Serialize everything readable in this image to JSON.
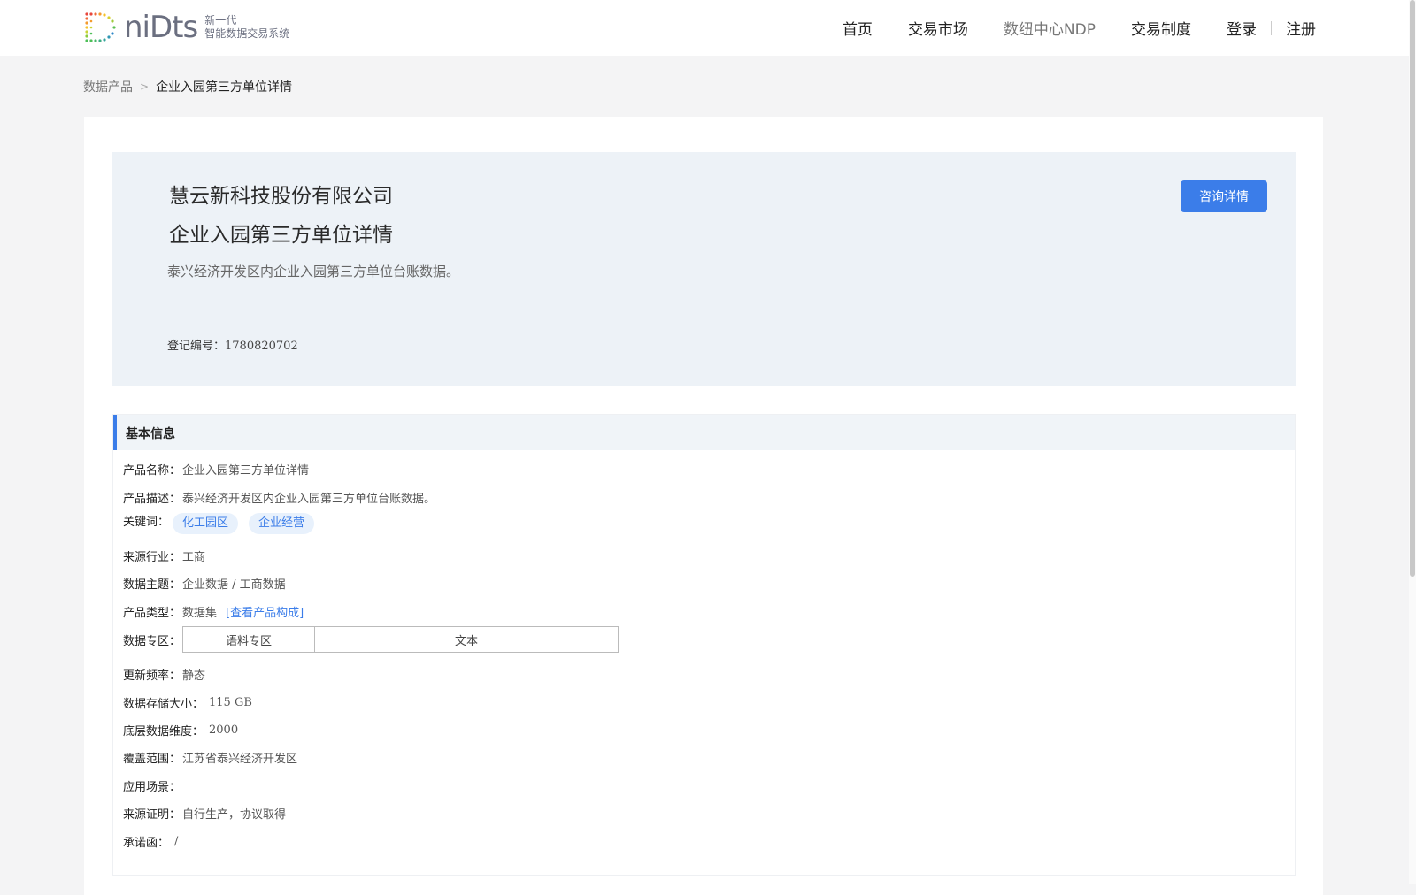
{
  "header": {
    "logo_word": "niDts",
    "logo_sub_line1": "新一代",
    "logo_sub_line2": "智能数据交易系统",
    "nav": {
      "home": "首页",
      "market": "交易市场",
      "ndp": "数纽中心NDP",
      "rules": "交易制度",
      "login": "登录",
      "register": "注册"
    }
  },
  "breadcrumb": {
    "parent": "数据产品",
    "current": "企业入园第三方单位详情"
  },
  "hero": {
    "company": "慧云新科技股份有限公司",
    "title": "企业入园第三方单位详情",
    "description": "泰兴经济开发区内企业入园第三方单位台账数据。",
    "reg_label": "登记编号：",
    "reg_value": "1780820702",
    "consult_button": "咨询详情"
  },
  "info": {
    "section_title": "基本信息",
    "product_name": {
      "label": "产品名称：",
      "value": "企业入园第三方单位详情"
    },
    "product_desc": {
      "label": "产品描述：",
      "value": "泰兴经济开发区内企业入园第三方单位台账数据。"
    },
    "keywords": {
      "label": "关键词：",
      "tags": [
        "化工园区",
        "企业经营"
      ]
    },
    "industry": {
      "label": "来源行业：",
      "value": "工商"
    },
    "topic": {
      "label": "数据主题：",
      "value": "企业数据 / 工商数据"
    },
    "product_type": {
      "label": "产品类型：",
      "value": "数据集",
      "link": "[查看产品构成]"
    },
    "zone": {
      "label": "数据专区：",
      "col1": "语料专区",
      "col2": "文本"
    },
    "frequency": {
      "label": "更新频率：",
      "value": "静态"
    },
    "storage": {
      "label": "数据存储大小：",
      "value": "115 GB"
    },
    "dimension": {
      "label": "底层数据维度：",
      "value": "2000"
    },
    "coverage": {
      "label": "覆盖范围：",
      "value": "江苏省泰兴经济开发区"
    },
    "scenario": {
      "label": "应用场景：",
      "value": ""
    },
    "source_proof": {
      "label": "来源证明：",
      "value": "自行生产，协议取得"
    },
    "commitment": {
      "label": "承诺函：",
      "value": "/"
    }
  },
  "colors": {
    "accent": "#3b7de9",
    "hero_bg": "#edf2f7",
    "page_bg": "#f4f4f5"
  }
}
